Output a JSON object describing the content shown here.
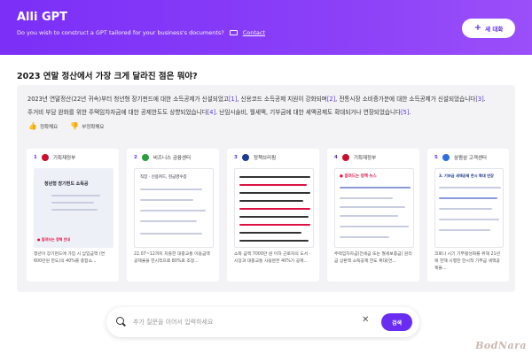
{
  "header": {
    "title": "Alli GPT",
    "subtitle": "Do you wish to construct a GPT tailored for your business's documents?",
    "contact_label": "Contact",
    "new_chat_label": "새 대화"
  },
  "question": "2023 연말 정산에서 가장 크게 달라진 점은 뭐야?",
  "answer": {
    "line1": "2023년 연말정산(22년 귀속)부터 청년형 장기펀드에 대한 소득공제가 신설되었고",
    "c1": "[1]",
    "line1b": ", 신용코드 소득공제 지원이 강화되며",
    "c2": "[2]",
    "line1c": ", 전통시장 소비증가분에 대한 소득공제가 신설되었습니다",
    "c3": "[3]",
    "line1d": ".",
    "line2": "주거비 부담 완화를 위한 주택임차자금에 대한 공제한도도 상향되었습니다",
    "c4": "[4]",
    "line2b": ". 난임시술비, 월세액, 기부금에 대한 세액공제도 확대되거나 연장되었습니다",
    "c5": "[5]",
    "line2c": "."
  },
  "feedback": {
    "helpful": "정확해요",
    "not_helpful": "부정확해요"
  },
  "sources": [
    {
      "num": "1",
      "name": "기획재정부",
      "logo_color": "#c8102e",
      "thumb_title": "청년형 장기펀드 소득공",
      "thumb_alert": "● 알려드는 정책 안내",
      "snippet": "청년이 장기펀드에 가입 시 납입금액 (연 600만원 한도)의 40%를 종합소..."
    },
    {
      "num": "2",
      "name": "비즈니스 금융센터",
      "logo_color": "#2a9d3f",
      "thumb_title": "직장 · 신용카드, 현금영수증",
      "thumb_alert": "",
      "snippet": "22.07~12까지 지출한 대중교통 이용금액 공제율을 한시적으로 80%로 조정..."
    },
    {
      "num": "3",
      "name": "정책브리핑",
      "logo_color": "#1f3b8f",
      "thumb_title": "",
      "thumb_alert": "",
      "snippet": "소득 금액 7000만 원 이하 근로자의 도서 · 시장과 대중교통 사용분은 40%가 공제..."
    },
    {
      "num": "4",
      "name": "기획재정부",
      "logo_color": "#c8102e",
      "thumb_title": "● 알려드는 정책 뉴스",
      "thumb_alert": "",
      "snippet": "주택임차자금(전세금 또는 월세보증금) 원리금 상환액 소득공제 한도 확대(연..."
    },
    {
      "num": "5",
      "name": "삼쩜삼 고객센터",
      "logo_color": "#2b6fe0",
      "thumb_title": "3. 기부금 세액공제 한시 확대 연장",
      "thumb_alert": "",
      "snippet": "코로나 시기 기부활성화를 위해 21년에 한해 시행한 한시적 기부금 세액공제율..."
    }
  ],
  "input": {
    "placeholder": "추가 질문을 이어서 입력하세요",
    "search_label": "검색"
  }
}
